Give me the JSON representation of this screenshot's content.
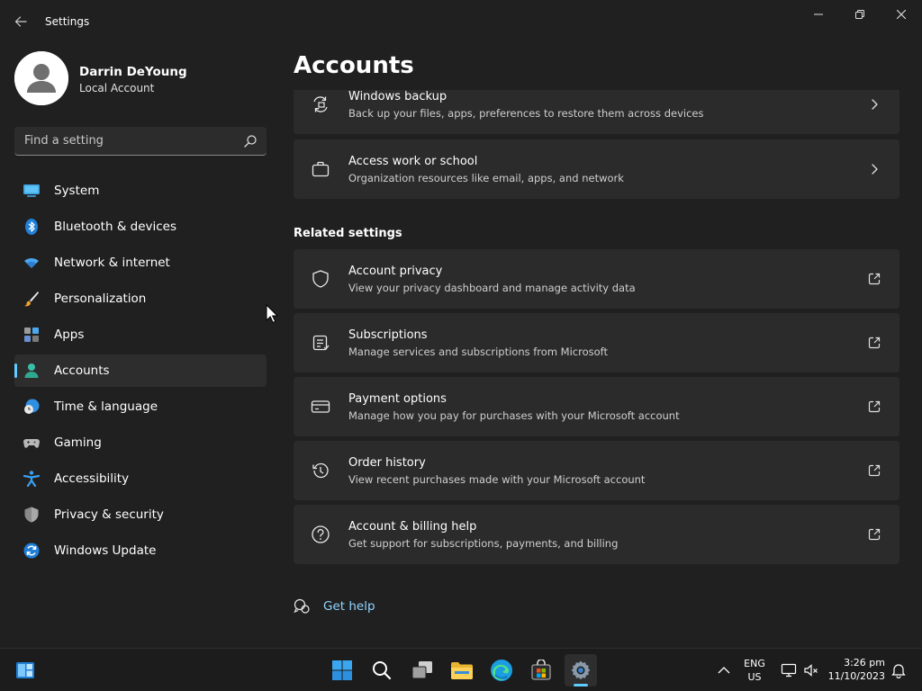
{
  "window": {
    "title": "Settings",
    "controls": {
      "minimize": "minimize",
      "maximize": "restore",
      "close": "close"
    }
  },
  "profile": {
    "name": "Darrin DeYoung",
    "account_type": "Local Account"
  },
  "search": {
    "placeholder": "Find a setting"
  },
  "nav": {
    "items": [
      {
        "label": "System",
        "icon": "monitor-icon",
        "active": false
      },
      {
        "label": "Bluetooth & devices",
        "icon": "bluetooth-icon",
        "active": false
      },
      {
        "label": "Network & internet",
        "icon": "wifi-icon",
        "active": false
      },
      {
        "label": "Personalization",
        "icon": "brush-icon",
        "active": false
      },
      {
        "label": "Apps",
        "icon": "apps-icon",
        "active": false
      },
      {
        "label": "Accounts",
        "icon": "person-icon",
        "active": true
      },
      {
        "label": "Time & language",
        "icon": "globe-clock-icon",
        "active": false
      },
      {
        "label": "Gaming",
        "icon": "gamepad-icon",
        "active": false
      },
      {
        "label": "Accessibility",
        "icon": "accessibility-icon",
        "active": false
      },
      {
        "label": "Privacy & security",
        "icon": "shield-icon",
        "active": false
      },
      {
        "label": "Windows Update",
        "icon": "update-icon",
        "active": false
      }
    ]
  },
  "main": {
    "title": "Accounts",
    "cards": [
      {
        "title": "Windows backup",
        "description": "Back up your files, apps, preferences to restore them across devices",
        "icon": "backup-icon",
        "trail": "chevron-right-icon"
      },
      {
        "title": "Access work or school",
        "description": "Organization resources like email, apps, and network",
        "icon": "briefcase-icon",
        "trail": "chevron-right-icon"
      }
    ],
    "related_heading": "Related settings",
    "related": [
      {
        "title": "Account privacy",
        "description": "View your privacy dashboard and manage activity data",
        "icon": "shield-outline-icon",
        "trail": "external-link-icon"
      },
      {
        "title": "Subscriptions",
        "description": "Manage services and subscriptions from Microsoft",
        "icon": "subscription-list-icon",
        "trail": "external-link-icon"
      },
      {
        "title": "Payment options",
        "description": "Manage how you pay for purchases with your Microsoft account",
        "icon": "credit-card-icon",
        "trail": "external-link-icon"
      },
      {
        "title": "Order history",
        "description": "View recent purchases made with your Microsoft account",
        "icon": "history-icon",
        "trail": "external-link-icon"
      },
      {
        "title": "Account & billing help",
        "description": "Get support for subscriptions, payments, and billing",
        "icon": "help-circle-icon",
        "trail": "external-link-icon"
      }
    ],
    "get_help": "Get help"
  },
  "taskbar": {
    "apps": [
      "widgets",
      "start",
      "search",
      "task-view",
      "file-explorer",
      "edge",
      "store",
      "settings"
    ],
    "language": {
      "line1": "ENG",
      "line2": "US"
    },
    "clock": {
      "time": "3:26 pm",
      "date": "11/10/2023"
    }
  },
  "colors": {
    "accent": "#60cdff",
    "background": "#202020",
    "card": "#2b2b2b",
    "link": "#8fd4ff"
  }
}
